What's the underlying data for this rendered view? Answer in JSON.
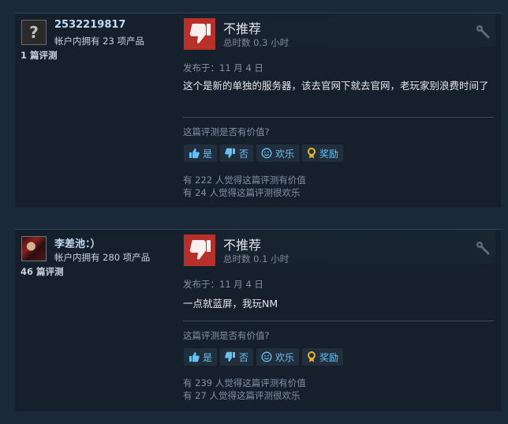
{
  "reviews": [
    {
      "author": {
        "name": "2532219817",
        "avatar_icon": "question-mark-avatar",
        "avatar_glyph": "?",
        "products_owned": "帐户内拥有 23 项产品",
        "review_count": "1 篇评测"
      },
      "verdict": "不推荐",
      "hours": "总时数 0.3 小时",
      "posted": "发布于：11 月 4 日",
      "content": "这个是新的单独的服务器，该去官网下就去官网，老玩家别浪费时间了",
      "helpful_question": "这篇评测是否有价值?",
      "buttons": {
        "yes": "是",
        "no": "否",
        "funny": "欢乐",
        "award": "奖励"
      },
      "helpful_stat": "有 222 人觉得这篇评测有价值",
      "funny_stat": "有 24 人觉得这篇评测很欢乐"
    },
    {
      "author": {
        "name": "李差池：）",
        "avatar_icon": "character-portrait-avatar",
        "products_owned": "帐户内拥有 280 项产品",
        "review_count": "46 篇评测"
      },
      "verdict": "不推荐",
      "hours": "总时数 0.1 小时",
      "posted": "发布于：11 月 4 日",
      "content": "一点就蓝屏，我玩NM",
      "helpful_question": "这篇评测是否有价值?",
      "buttons": {
        "yes": "是",
        "no": "否",
        "funny": "欢乐",
        "award": "奖励"
      },
      "helpful_stat": "有 239 人觉得这篇评测有价值",
      "funny_stat": "有 27 人觉得这篇评测很欢乐"
    }
  ],
  "colors": {
    "background": "#1b2838",
    "card": "#16202d",
    "thumbs_down_bg": "#b7302a",
    "link_blue": "#67c1f5",
    "award_gold": "#e3b42f"
  }
}
